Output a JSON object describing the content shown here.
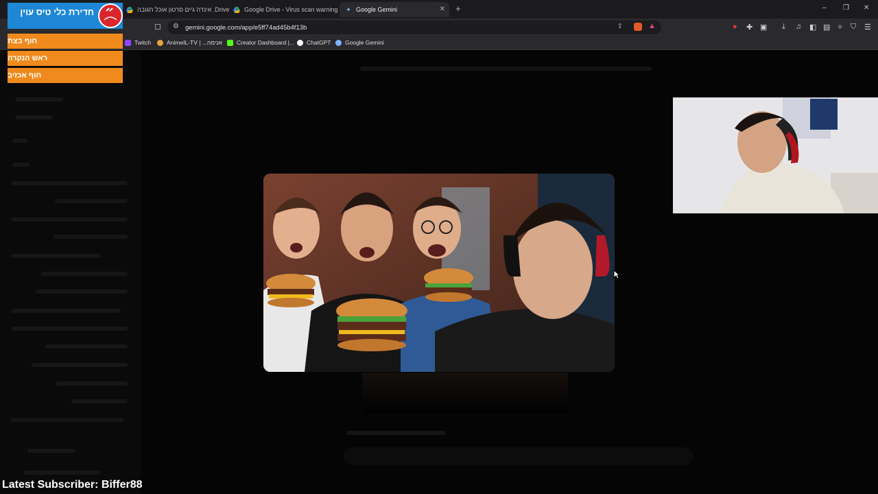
{
  "browser": {
    "tabs": [
      {
        "label": "אינדה גיים סרטון אוכל תגובה .Drive",
        "active": false
      },
      {
        "label": "Google Drive - Virus scan warning",
        "active": false
      },
      {
        "label": "Google Gemini",
        "active": true
      }
    ],
    "new_tab_symbol": "+",
    "url": "gemini.google.com/app/e5ff74ad45b4f13b",
    "bookmarks": [
      "Twitch",
      "AnimeIL-TV | ...אנימה",
      "Creator Dashboard |...",
      "ChatGPT",
      "Google Gemini"
    ],
    "window_controls": [
      "–",
      "❐",
      "✕"
    ]
  },
  "overlay": {
    "channel_name": "חדירת כלי טיס עוין",
    "rows": [
      "חוף בצת",
      "ראש הנקרה",
      "חוף אכזיב"
    ],
    "latest_subscriber": "Latest Subscriber: Biffer88"
  },
  "colors": {
    "tag_blue": "#1e88d6",
    "tag_orange": "#f08a1c",
    "tag_red": "#d9252b"
  }
}
